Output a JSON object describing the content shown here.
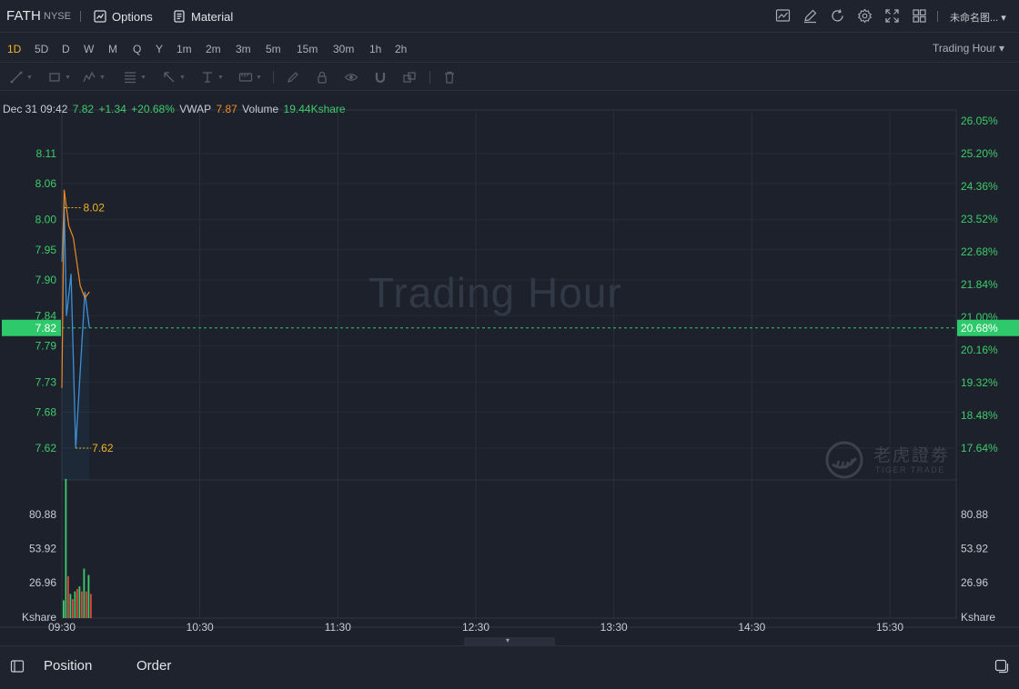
{
  "header": {
    "symbol": "FATH",
    "exchange": "NYSE",
    "options_label": "Options",
    "material_label": "Material",
    "layout_name": "未命名图...",
    "icons": [
      "chart-icon",
      "edit-icon",
      "refresh-icon",
      "settings-icon",
      "fullscreen-icon",
      "grid-layout-icon"
    ]
  },
  "timeframes": {
    "items": [
      "1D",
      "5D",
      "D",
      "W",
      "M",
      "Q",
      "Y",
      "1m",
      "2m",
      "3m",
      "5m",
      "15m",
      "30m",
      "1h",
      "2h"
    ],
    "active": "1D",
    "session_label": "Trading Hour",
    "session_caret": "▾"
  },
  "drawing_tools": [
    "line-tool-icon",
    "rectangle-tool-icon",
    "pattern-tool-icon",
    "fib-tool-icon",
    "arrow-tool-icon",
    "text-tool-icon",
    "measure-tool-icon",
    "pencil-icon",
    "lock-icon",
    "eye-icon",
    "magnet-icon",
    "clone-icon",
    "trash-icon"
  ],
  "info": {
    "datetime": "Dec 31 09:42",
    "price": "7.82",
    "change": "+1.34",
    "change_pct": "+20.68%",
    "vwap_label": "VWAP",
    "vwap": "7.87",
    "volume_label": "Volume",
    "volume": "19.44Kshare"
  },
  "watermark": {
    "text": "Trading Hour",
    "logo_cn": "老虎證劵",
    "logo_en": "TIGER TRADE"
  },
  "chart_data": {
    "type": "line",
    "price_axis": [
      "8.11",
      "8.06",
      "8.00",
      "7.95",
      "7.90",
      "7.84",
      "7.79",
      "7.73",
      "7.68",
      "7.62"
    ],
    "pct_axis": [
      "26.05%",
      "25.20%",
      "24.36%",
      "23.52%",
      "22.68%",
      "21.84%",
      "21.00%",
      "20.16%",
      "19.32%",
      "18.48%",
      "17.64%"
    ],
    "current_price_label": "7.82",
    "current_pct_label": "20.68%",
    "high_annotation": "8.02",
    "low_annotation": "7.62",
    "x_ticks": [
      "09:30",
      "10:30",
      "11:30",
      "12:30",
      "13:30",
      "14:30",
      "15:30"
    ],
    "price_series": [
      {
        "t": "09:30",
        "v": 7.93
      },
      {
        "t": "09:31",
        "v": 8.03
      },
      {
        "t": "09:32",
        "v": 7.84
      },
      {
        "t": "09:34",
        "v": 7.91
      },
      {
        "t": "09:36",
        "v": 7.62
      },
      {
        "t": "09:40",
        "v": 7.88
      },
      {
        "t": "09:42",
        "v": 7.82
      }
    ],
    "vwap_series": [
      {
        "t": "09:30",
        "v": 7.72
      },
      {
        "t": "09:31",
        "v": 8.05
      },
      {
        "t": "09:33",
        "v": 7.99
      },
      {
        "t": "09:35",
        "v": 7.97
      },
      {
        "t": "09:38",
        "v": 7.89
      },
      {
        "t": "09:40",
        "v": 7.87
      },
      {
        "t": "09:42",
        "v": 7.88
      }
    ],
    "volume_axis": [
      "80.88",
      "53.92",
      "26.96"
    ],
    "volume_unit": "Kshare",
    "volume_bars": [
      {
        "v": 13,
        "up": true
      },
      {
        "v": 109,
        "up": true
      },
      {
        "v": 32,
        "up": false
      },
      {
        "v": 18,
        "up": true
      },
      {
        "v": 14,
        "up": false
      },
      {
        "v": 20,
        "up": true
      },
      {
        "v": 22,
        "up": false
      },
      {
        "v": 24,
        "up": true
      },
      {
        "v": 20,
        "up": false
      },
      {
        "v": 38,
        "up": true
      },
      {
        "v": 20,
        "up": false
      },
      {
        "v": 33,
        "up": true
      },
      {
        "v": 18,
        "up": false
      }
    ],
    "colors": {
      "price_line": "#3d8fd6",
      "vwap_line": "#f08a24",
      "up": "#3fcb6b",
      "down": "#e0433f",
      "current": "#2ec96a",
      "annotation": "#f0b429"
    }
  },
  "bottom_panel": {
    "tabs": [
      "Position",
      "Order"
    ]
  }
}
